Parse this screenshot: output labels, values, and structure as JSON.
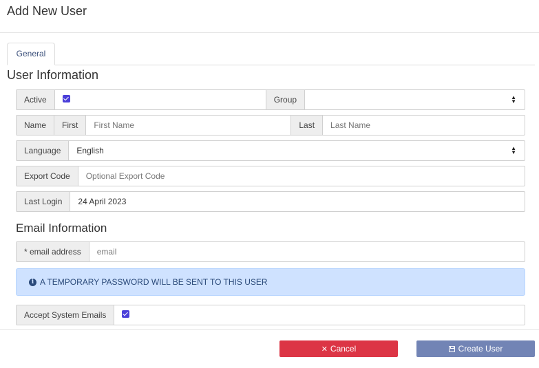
{
  "dialog": {
    "title": "Add New User"
  },
  "tabs": [
    {
      "label": "General"
    }
  ],
  "user_info": {
    "title": "User Information",
    "active": {
      "label": "Active",
      "checked": true
    },
    "group": {
      "label": "Group",
      "value": ""
    },
    "name": {
      "label": "Name",
      "first_label": "First",
      "first_placeholder": "First Name",
      "last_label": "Last",
      "last_placeholder": "Last Name"
    },
    "language": {
      "label": "Language",
      "value": "English"
    },
    "export_code": {
      "label": "Export Code",
      "placeholder": "Optional Export Code"
    },
    "last_login": {
      "label": "Last Login",
      "value": "24 April 2023"
    }
  },
  "email_info": {
    "title": "Email Information",
    "email": {
      "label": "* email address",
      "placeholder": "email"
    },
    "alert": "A TEMPORARY PASSWORD WILL BE SENT TO THIS USER",
    "accept_emails": {
      "label": "Accept System Emails",
      "checked": true
    }
  },
  "buttons": {
    "cancel": "Cancel",
    "create": "Create User"
  },
  "icons": {
    "cancel": "close-icon",
    "create": "save-icon",
    "alert": "info-icon",
    "select": "sort-arrows-icon"
  },
  "colors": {
    "cancel": "#dc3545",
    "create": "#7284b5",
    "checkbox": "#4b3fd9",
    "alert_bg": "#cfe2ff"
  }
}
